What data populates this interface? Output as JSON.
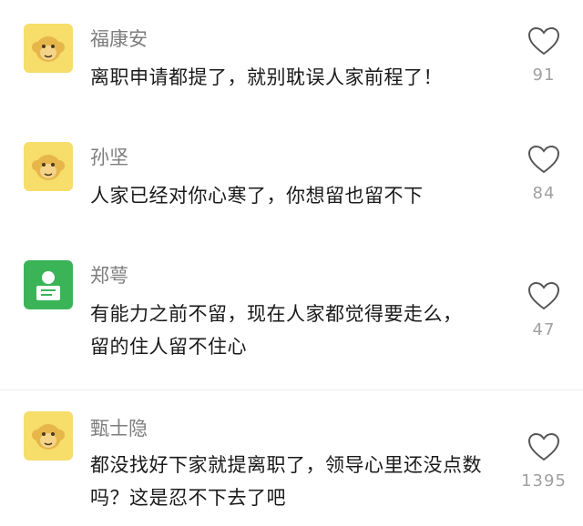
{
  "comments": [
    {
      "name": "福康安",
      "text": "离职申请都提了，就别耽误人家前程了！",
      "likes": "91",
      "avatar": "monkey-avatar"
    },
    {
      "name": "孙坚",
      "text": "人家已经对你心寒了，你想留也留不下",
      "likes": "84",
      "avatar": "monkey-avatar"
    },
    {
      "name": "郑萼",
      "text": "有能力之前不留，现在人家都觉得要走么，留的住人留不住心",
      "likes": "47",
      "avatar": "default-user-avatar"
    },
    {
      "name": "甄士隐",
      "text": "都没找好下家就提离职了，领导心里还没点数吗？这是忍不下去了吧",
      "likes": "1395",
      "avatar": "monkey-avatar"
    }
  ],
  "colors": {
    "monkey_bg": "#f7dd6a",
    "monkey_face": "#e6b64a",
    "default_avatar_bg": "#3bb458",
    "name_text": "#7d7d7d",
    "like_count": "#a0a0a0"
  }
}
